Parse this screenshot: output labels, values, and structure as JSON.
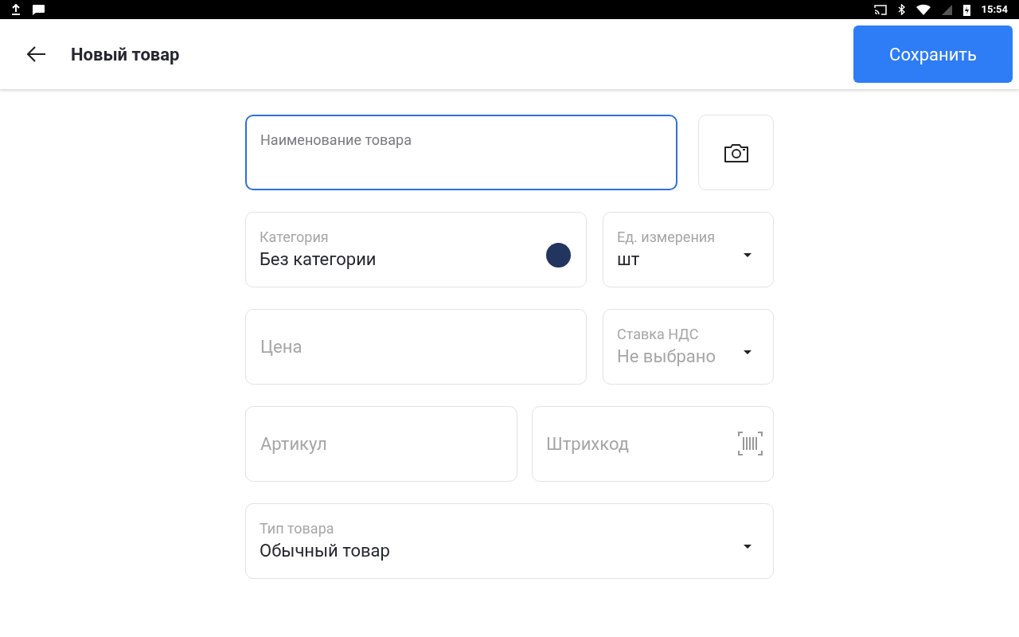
{
  "status_bar": {
    "time": "15:54"
  },
  "header": {
    "title": "Новый товар",
    "save_button": "Сохранить"
  },
  "rows": [
    [
      {
        "kind": "text",
        "placeholder": "Наименование товара",
        "focused": true
      },
      {
        "kind": "photo"
      }
    ],
    [
      {
        "kind": "picker",
        "label": "Категория",
        "value": "Без категории",
        "color": "#22355e"
      },
      {
        "kind": "select",
        "label": "Ед. измерения",
        "value": "шт"
      }
    ],
    [
      {
        "kind": "text",
        "placeholder": "Цена",
        "focused": false
      },
      {
        "kind": "select",
        "label": "Ставка НДС",
        "placeholder": "Не выбрано"
      }
    ],
    [
      {
        "kind": "text",
        "placeholder": "Артикул",
        "focused": false
      },
      {
        "kind": "barcode",
        "placeholder": "Штрихкод"
      }
    ],
    [
      {
        "kind": "select",
        "label": "Тип товара",
        "value": "Обычный товар"
      }
    ]
  ]
}
